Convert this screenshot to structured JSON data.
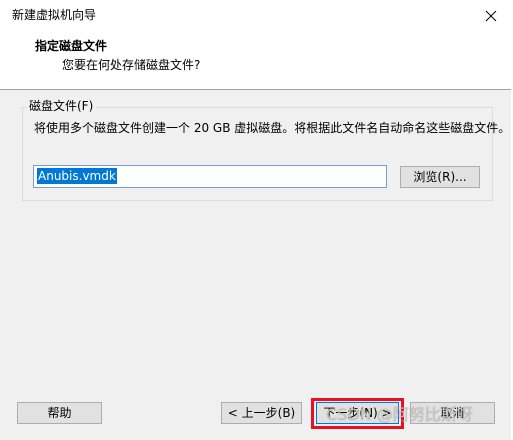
{
  "window": {
    "title": "新建虚拟机向导",
    "close_icon": "close-icon"
  },
  "header": {
    "heading": "指定磁盘文件",
    "subheading": "您要在何处存储磁盘文件?"
  },
  "disk_file_group": {
    "legend": "磁盘文件(F)",
    "description": "将使用多个磁盘文件创建一个 20 GB 虚拟磁盘。将根据此文件名自动命名这些磁盘文件。",
    "file_name_value": "Anubis.vmdk",
    "browse_label": "浏览(R)..."
  },
  "footer": {
    "help_label": "帮助",
    "prev_label": "< 上一步(B)",
    "next_label": "下一步(N) >",
    "cancel_label": "取消"
  },
  "watermark": {
    "text": "CSDN @阿努比斯呀"
  },
  "colors": {
    "highlight": "#e81123",
    "selection": "#0078d7"
  }
}
